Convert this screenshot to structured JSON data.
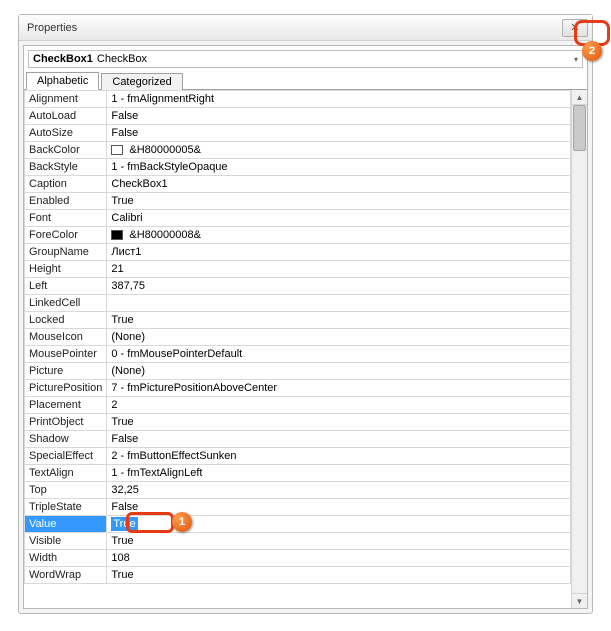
{
  "window": {
    "title": "Properties"
  },
  "object_selector": {
    "name": "CheckBox1",
    "type": "CheckBox"
  },
  "tabs": {
    "alphabetic": "Alphabetic",
    "categorized": "Categorized",
    "active": "alphabetic"
  },
  "selected_property": "Value",
  "editor_value": "True",
  "properties": [
    {
      "name": "Alignment",
      "value": "1 - fmAlignmentRight"
    },
    {
      "name": "AutoLoad",
      "value": "False"
    },
    {
      "name": "AutoSize",
      "value": "False"
    },
    {
      "name": "BackColor",
      "swatch": "white",
      "value": "&H80000005&"
    },
    {
      "name": "BackStyle",
      "value": "1 - fmBackStyleOpaque"
    },
    {
      "name": "Caption",
      "value": "CheckBox1"
    },
    {
      "name": "Enabled",
      "value": "True"
    },
    {
      "name": "Font",
      "value": "Calibri"
    },
    {
      "name": "ForeColor",
      "swatch": "black",
      "value": "&H80000008&"
    },
    {
      "name": "GroupName",
      "value": "Лист1"
    },
    {
      "name": "Height",
      "value": "21"
    },
    {
      "name": "Left",
      "value": "387,75"
    },
    {
      "name": "LinkedCell",
      "value": ""
    },
    {
      "name": "Locked",
      "value": "True"
    },
    {
      "name": "MouseIcon",
      "value": "(None)"
    },
    {
      "name": "MousePointer",
      "value": "0 - fmMousePointerDefault"
    },
    {
      "name": "Picture",
      "value": "(None)"
    },
    {
      "name": "PicturePosition",
      "value": "7 - fmPicturePositionAboveCenter"
    },
    {
      "name": "Placement",
      "value": "2"
    },
    {
      "name": "PrintObject",
      "value": "True"
    },
    {
      "name": "Shadow",
      "value": "False"
    },
    {
      "name": "SpecialEffect",
      "value": "2 - fmButtonEffectSunken"
    },
    {
      "name": "TextAlign",
      "value": "1 - fmTextAlignLeft"
    },
    {
      "name": "Top",
      "value": "32,25"
    },
    {
      "name": "TripleState",
      "value": "False"
    },
    {
      "name": "Value",
      "value": "True"
    },
    {
      "name": "Visible",
      "value": "True"
    },
    {
      "name": "Width",
      "value": "108"
    },
    {
      "name": "WordWrap",
      "value": "True"
    }
  ],
  "callouts": {
    "1": "1",
    "2": "2"
  },
  "icons": {
    "close": "✕",
    "chevron_down": "▾",
    "arrow_up": "▲",
    "arrow_down": "▼"
  }
}
